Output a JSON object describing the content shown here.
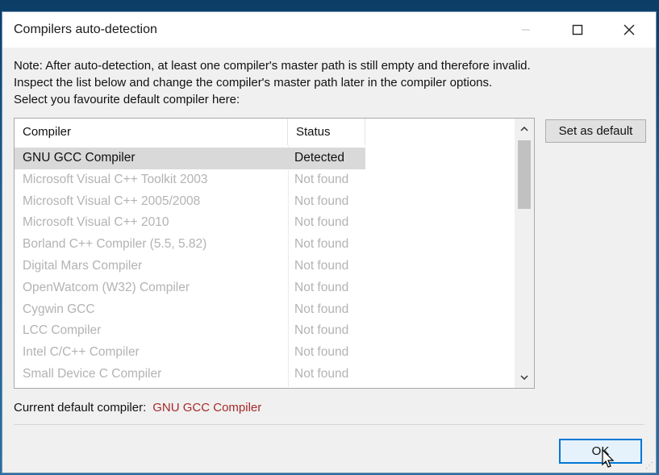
{
  "window": {
    "title": "Compilers auto-detection",
    "minimize_icon": "minimize-icon",
    "maximize_icon": "maximize-icon",
    "close_icon": "close-icon"
  },
  "note": {
    "line1": "Note: After auto-detection, at least one compiler's master path is still empty and therefore invalid.",
    "line2": "Inspect the list below and change the compiler's master path later in the compiler options.",
    "line3": "Select you favourite default compiler here:"
  },
  "list": {
    "columns": [
      "Compiler",
      "Status"
    ],
    "rows": [
      {
        "compiler": "GNU GCC Compiler",
        "status": "Detected"
      },
      {
        "compiler": "Microsoft Visual C++ Toolkit 2003",
        "status": "Not found"
      },
      {
        "compiler": "Microsoft Visual C++ 2005/2008",
        "status": "Not found"
      },
      {
        "compiler": "Microsoft Visual C++ 2010",
        "status": "Not found"
      },
      {
        "compiler": "Borland C++ Compiler (5.5, 5.82)",
        "status": "Not found"
      },
      {
        "compiler": "Digital Mars Compiler",
        "status": "Not found"
      },
      {
        "compiler": "OpenWatcom (W32) Compiler",
        "status": "Not found"
      },
      {
        "compiler": "Cygwin GCC",
        "status": "Not found"
      },
      {
        "compiler": "LCC Compiler",
        "status": "Not found"
      },
      {
        "compiler": "Intel C/C++ Compiler",
        "status": "Not found"
      },
      {
        "compiler": "Small Device C Compiler",
        "status": "Not found"
      }
    ],
    "selected_index": 0
  },
  "buttons": {
    "set_default": "Set as default",
    "ok": "OK"
  },
  "current": {
    "label": "Current default compiler:",
    "value": "GNU GCC Compiler"
  },
  "colors": {
    "accent": "#0078d7",
    "current_value": "#a52a2a"
  }
}
